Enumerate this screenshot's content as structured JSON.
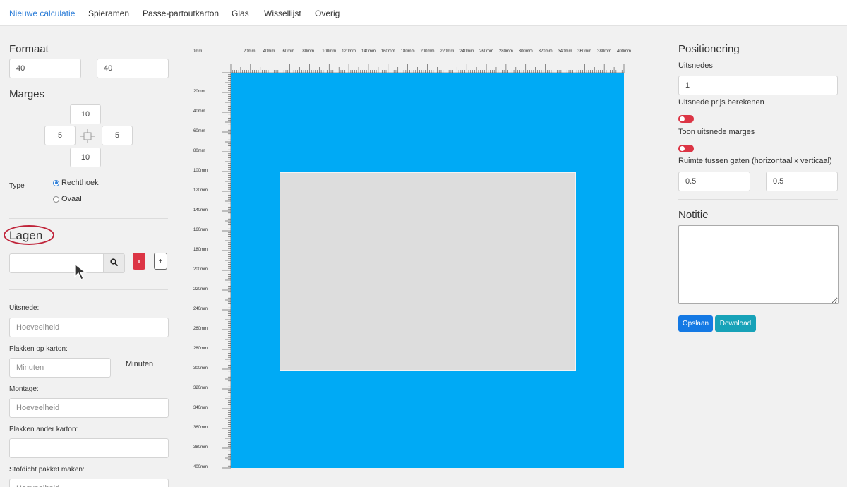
{
  "nav": {
    "items": [
      {
        "label": "Nieuwe calculatie",
        "active": true
      },
      {
        "label": "Spieramen",
        "active": false
      },
      {
        "label": "Passe-partoutkarton",
        "active": false
      },
      {
        "label": "Glas",
        "active": false
      },
      {
        "label": "Wissellijst",
        "active": false
      },
      {
        "label": "Overig",
        "active": false
      }
    ]
  },
  "left": {
    "formaat": {
      "title": "Formaat",
      "width": "40",
      "height": "40"
    },
    "marges": {
      "title": "Marges",
      "top": "10",
      "left": "5",
      "right": "5",
      "bottom": "10"
    },
    "type": {
      "label": "Type",
      "options": [
        "Rechthoek",
        "Ovaal"
      ],
      "selected": "Rechthoek"
    },
    "lagen": {
      "title": "Lagen",
      "search_value": "",
      "remove_label": "x",
      "add_label": "+"
    },
    "fields": {
      "uitsnede_label": "Uitsnede:",
      "uitsnede_placeholder": "Hoeveelheid",
      "plakken_label": "Plakken op karton:",
      "plakken_placeholder": "Minuten",
      "plakken_unit": "Minuten",
      "montage_label": "Montage:",
      "montage_placeholder": "Hoeveelheid",
      "plakken_ander_label": "Plakken ander karton:",
      "plakken_ander_value": "",
      "stofdicht_label": "Stofdicht pakket maken:",
      "stofdicht_placeholder": "Hoeveelheid"
    }
  },
  "ruler": {
    "top_labels": [
      "0mm",
      "20mm",
      "40mm",
      "60mm",
      "80mm",
      "100mm",
      "120mm",
      "140mm",
      "160mm",
      "180mm",
      "200mm",
      "220mm",
      "240mm",
      "260mm",
      "280mm",
      "300mm",
      "320mm",
      "340mm",
      "360mm",
      "380mm",
      "400mm"
    ],
    "left_labels": [
      "20mm",
      "40mm",
      "60mm",
      "80mm",
      "100mm",
      "120mm",
      "140mm",
      "160mm",
      "180mm",
      "200mm",
      "220mm",
      "240mm",
      "260mm",
      "280mm",
      "300mm",
      "320mm",
      "340mm",
      "360mm",
      "380mm",
      "400mm"
    ]
  },
  "colors": {
    "passe_partout": "#00aaf5",
    "opening": "#dddddd",
    "accent": "#2f7fd8",
    "danger": "#dc3545"
  },
  "right": {
    "positionering": {
      "title": "Positionering",
      "uitsnedes_label": "Uitsnedes",
      "uitsnedes_value": "1",
      "prijs_label": "Uitsnede prijs berekenen",
      "prijs_on": false,
      "marges_label": "Toon uitsnede marges",
      "marges_on": false,
      "ruimte_label": "Ruimte tussen gaten (horizontaal x verticaal)",
      "ruimte_h": "0.5",
      "ruimte_v": "0.5"
    },
    "notitie": {
      "title": "Notitie",
      "value": ""
    },
    "buttons": {
      "save": "Opslaan",
      "download": "Download"
    }
  },
  "icons": {
    "margin_center": "crosshair-square-icon",
    "search": "magnifier-icon",
    "cursor": "mouse-pointer-icon"
  }
}
